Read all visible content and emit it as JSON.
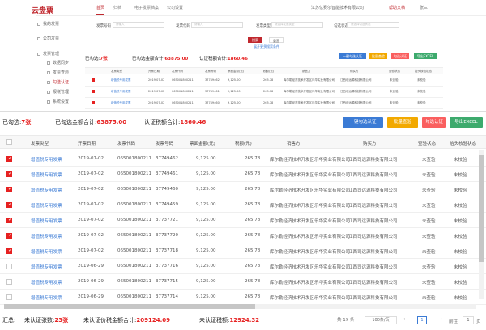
{
  "app": {
    "logo": "云盘票",
    "tabs": [
      "首页",
      "归档",
      "电子发票档案",
      "公司设置"
    ],
    "company": "江苏亿赛尔智能技术有限公司",
    "help": "帮助文档",
    "user": "张三"
  },
  "sidebar": {
    "items": [
      "我的发票",
      "公司发票",
      "发票管理",
      "数据同步",
      "发票查验",
      "勾选认证",
      "报税管理",
      "系统设置"
    ]
  },
  "filters": {
    "labels": [
      "发票号码",
      "发票代码",
      "发票类型",
      "勾选状态"
    ],
    "placeholders": [
      "请输入",
      "请输入",
      "请选择发票类型",
      "请选择勾选状态"
    ],
    "search": "搜索",
    "reset": "重置",
    "more": "展开更多搜索条件"
  },
  "summary": {
    "selected_label": "已勾选:",
    "selected_value": "7张",
    "amount_label": "已勾选金额合计:",
    "amount_value": "63875.00",
    "tax_label": "认证税额合计:",
    "tax_value": "1860.46"
  },
  "actions": {
    "one_click": "一键勾选认证",
    "batch_verify": "批量查验",
    "submit": "勾选认证",
    "export": "导出EXCEL"
  },
  "table": {
    "headers": [
      "发票类型",
      "开票日期",
      "发票代码",
      "发票号码",
      "票面金额(元)",
      "税额(元)",
      "销售方",
      "购买方",
      "查验状态",
      "抬头核验状态"
    ],
    "rows": [
      {
        "checked": true,
        "type": "增值税专用发票",
        "date": "2019-07-02",
        "code": "065001800211",
        "number": "37749462",
        "amount": "9,125.00",
        "tax": "265.78",
        "seller": "库尔勒经济技术开发区乐华实业有限公司",
        "buyer": "江西司远源科技有限公司",
        "verify": "未查验",
        "title": "未校验"
      },
      {
        "checked": true,
        "type": "增值税专用发票",
        "date": "2019-07-02",
        "code": "065001800211",
        "number": "37749461",
        "amount": "9,125.00",
        "tax": "265.78",
        "seller": "库尔勒经济技术开发区乐华实业有限公司",
        "buyer": "江西司远源科技有限公司",
        "verify": "未查验",
        "title": "未校验"
      },
      {
        "checked": true,
        "type": "增值税专用发票",
        "date": "2019-07-02",
        "code": "065001800211",
        "number": "37749460",
        "amount": "9,125.00",
        "tax": "265.78",
        "seller": "库尔勒经济技术开发区乐华实业有限公司",
        "buyer": "江西司远源科技有限公司",
        "verify": "未查验",
        "title": "未校验"
      },
      {
        "checked": true,
        "type": "增值税专用发票",
        "date": "2019-07-02",
        "code": "065001800211",
        "number": "37749459",
        "amount": "9,125.00",
        "tax": "265.78",
        "seller": "库尔勒经济技术开发区乐华实业有限公司",
        "buyer": "江西司远源科技有限公司",
        "verify": "未查验",
        "title": "未校验"
      },
      {
        "checked": true,
        "type": "增值税专用发票",
        "date": "2019-07-02",
        "code": "065001800211",
        "number": "37737721",
        "amount": "9,125.00",
        "tax": "265.78",
        "seller": "库尔勒经济技术开发区乐华实业有限公司",
        "buyer": "江西司远源科技有限公司",
        "verify": "未查验",
        "title": "未校验"
      },
      {
        "checked": true,
        "type": "增值税专用发票",
        "date": "2019-07-02",
        "code": "065001800211",
        "number": "37737720",
        "amount": "9,125.00",
        "tax": "265.78",
        "seller": "库尔勒经济技术开发区乐华实业有限公司",
        "buyer": "江西司远源科技有限公司",
        "verify": "未查验",
        "title": "未校验"
      },
      {
        "checked": true,
        "type": "增值税专用发票",
        "date": "2019-07-02",
        "code": "065001800211",
        "number": "37737718",
        "amount": "9,125.00",
        "tax": "265.78",
        "seller": "库尔勒经济技术开发区乐华实业有限公司",
        "buyer": "江西司远源科技有限公司",
        "verify": "未查验",
        "title": "未校验"
      },
      {
        "checked": false,
        "type": "增值税专用发票",
        "date": "2019-06-29",
        "code": "065001800211",
        "number": "37737716",
        "amount": "9,125.00",
        "tax": "265.78",
        "seller": "库尔勒经济技术开发区乐华实业有限公司",
        "buyer": "江西司远源科技有限公司",
        "verify": "未查验",
        "title": "未校验"
      },
      {
        "checked": false,
        "type": "增值税专用发票",
        "date": "2019-06-29",
        "code": "065001800211",
        "number": "37737715",
        "amount": "9,125.00",
        "tax": "265.78",
        "seller": "库尔勒经济技术开发区乐华实业有限公司",
        "buyer": "江西司远源科技有限公司",
        "verify": "未查验",
        "title": "未校验"
      },
      {
        "checked": false,
        "type": "增值税专用发票",
        "date": "2019-06-29",
        "code": "065001800211",
        "number": "37737714",
        "amount": "9,125.00",
        "tax": "265.78",
        "seller": "库尔勒经济技术开发区乐华实业有限公司",
        "buyer": "江西司远源科技有限公司",
        "verify": "未查验",
        "title": "未校验"
      }
    ]
  },
  "footer": {
    "summary_label": "汇总:",
    "unverified_count_label": "未认证张数:",
    "unverified_count": "23张",
    "unverified_amount_label": "未认证价税金额合计:",
    "unverified_amount": "209124.09",
    "unverified_tax_label": "未认证税额:",
    "unverified_tax": "12924.32",
    "total": "共 19 条",
    "page_size": "100条/页",
    "current_page": "1",
    "goto_label": "前往",
    "goto_value": "1",
    "page_unit": "页"
  },
  "colors": {
    "brand": "#c0282e",
    "red": "#e62121",
    "blue": "#3b7bd5",
    "yellow": "#f2a900",
    "orange": "#fa5f5f",
    "green": "#3daa6d"
  }
}
